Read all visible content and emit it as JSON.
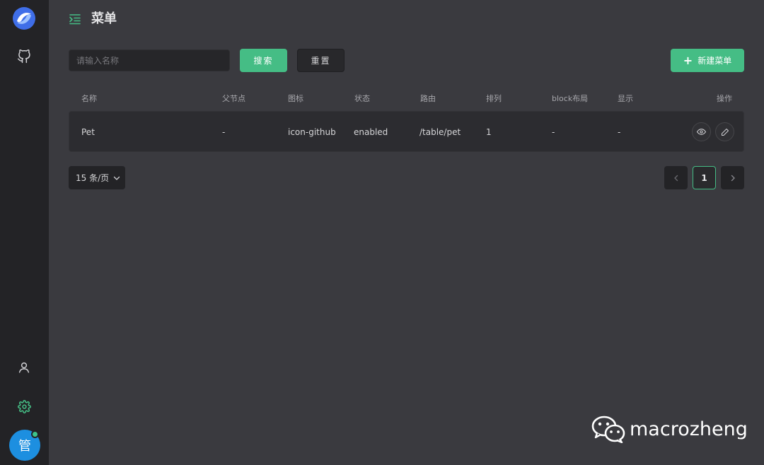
{
  "header": {
    "title": "菜单"
  },
  "search": {
    "placeholder": "请输入名称",
    "search_label": "搜索",
    "reset_label": "重置",
    "new_label": "新建菜单"
  },
  "table": {
    "columns": [
      "名称",
      "父节点",
      "图标",
      "状态",
      "路由",
      "排列",
      "block布局",
      "显示",
      "操作"
    ],
    "rows": [
      {
        "name": "Pet",
        "parent": "-",
        "icon": "icon-github",
        "status": "enabled",
        "route": "/table/pet",
        "order": "1",
        "block": "-",
        "show": "-"
      }
    ]
  },
  "pagination": {
    "page_size": "15 条/页",
    "current": "1"
  },
  "sidebar": {
    "avatar_text": "管",
    "icons": [
      "logo-icon",
      "github-icon",
      "user-icon",
      "settings-icon"
    ]
  },
  "watermark": {
    "text": "macrozheng"
  },
  "colors": {
    "accent": "#45bd85",
    "background": "#3a3a3f",
    "sidebar": "#232326",
    "avatar": "#1d8fe0"
  }
}
